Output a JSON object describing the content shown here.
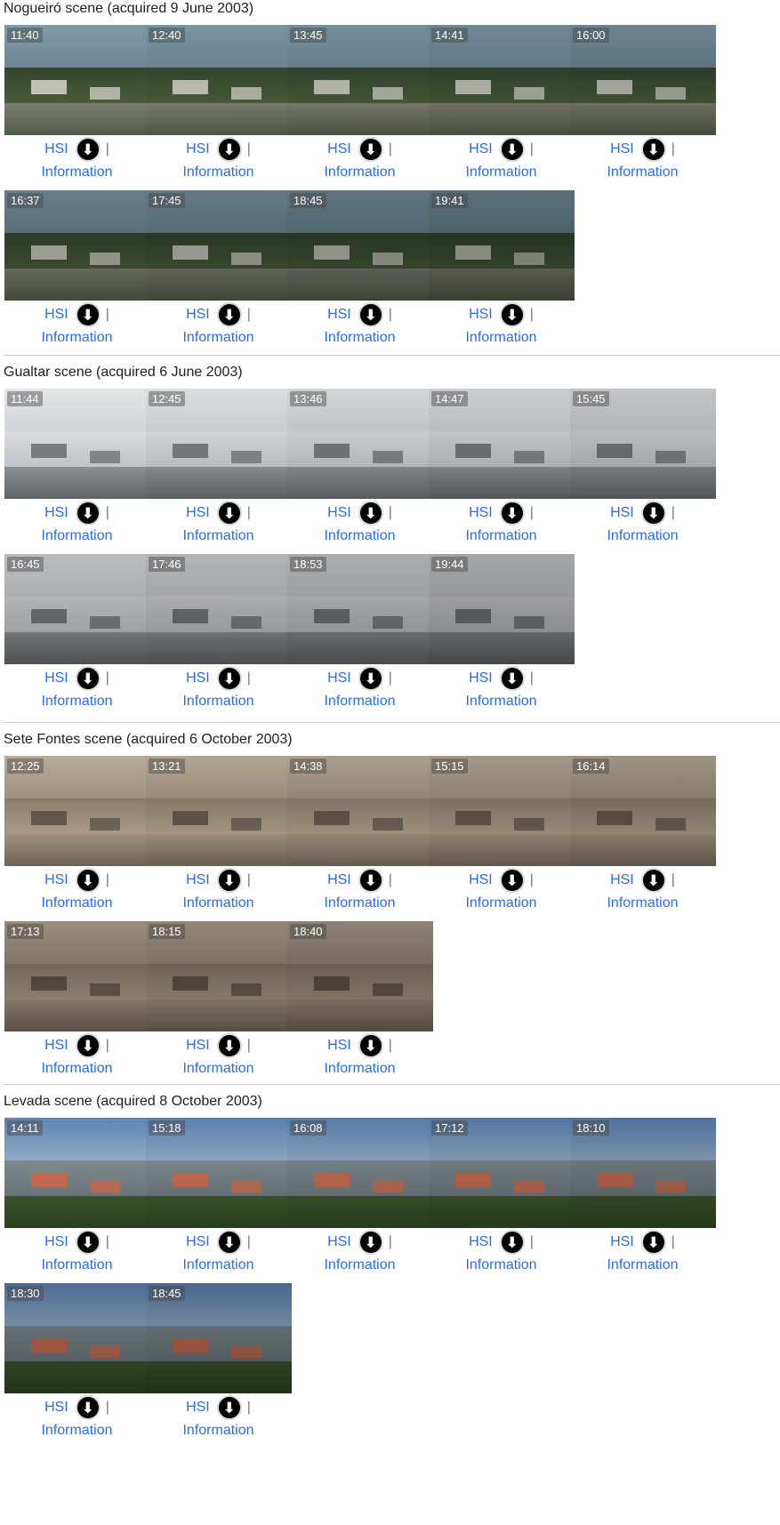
{
  "sections": [
    {
      "title": "Nogueiró scene (acquired 9 June 2003)",
      "scene": "village",
      "times": [
        "11:40",
        "12:40",
        "13:45",
        "14:41",
        "16:00",
        "16:37",
        "17:45",
        "18:45",
        "19:41"
      ]
    },
    {
      "title": "Gualtar scene (acquired 6 June 2003)",
      "scene": "building",
      "times": [
        "11:44",
        "12:45",
        "13:46",
        "14:47",
        "15:45",
        "16:45",
        "17:46",
        "18:53",
        "19:44"
      ]
    },
    {
      "title": "Sete Fontes scene (acquired 6 October 2003)",
      "scene": "rock",
      "times": [
        "12:25",
        "13:21",
        "14:38",
        "15:15",
        "16:14",
        "17:13",
        "18:15",
        "18:40"
      ]
    },
    {
      "title": "Levada scene (acquired 8 October 2003)",
      "scene": "mountain",
      "times": [
        "14:11",
        "15:18",
        "16:08",
        "17:12",
        "18:10",
        "18:30",
        "18:45"
      ]
    }
  ],
  "links": {
    "hsi_label": "HSI",
    "separator": "|",
    "info_label": "Information",
    "download_icon": "download-arrow-icon",
    "link_color": "#2a6cf0"
  }
}
